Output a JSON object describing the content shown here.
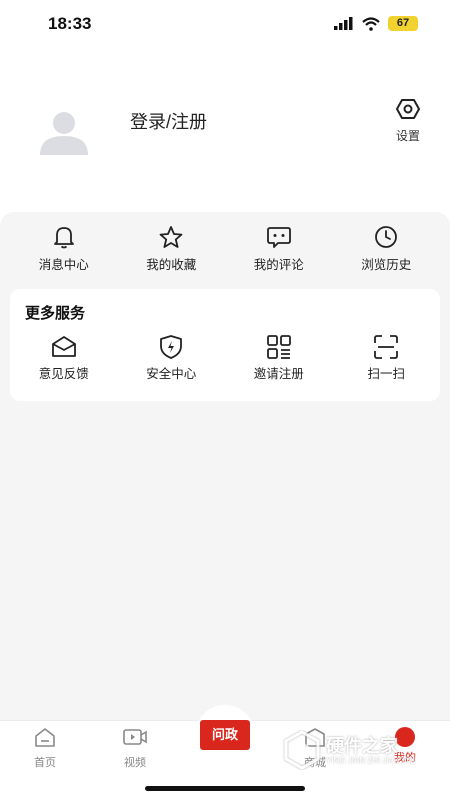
{
  "status_bar": {
    "time": "18:33",
    "battery": "67"
  },
  "profile": {
    "login_label": "登录/注册",
    "settings_label": "设置"
  },
  "quick_actions": [
    {
      "label": "消息中心",
      "icon": "bell-icon"
    },
    {
      "label": "我的收藏",
      "icon": "star-icon"
    },
    {
      "label": "我的评论",
      "icon": "comment-icon"
    },
    {
      "label": "浏览历史",
      "icon": "clock-icon"
    }
  ],
  "services": {
    "title": "更多服务",
    "items": [
      {
        "label": "意见反馈",
        "icon": "envelope-icon"
      },
      {
        "label": "安全中心",
        "icon": "shield-icon"
      },
      {
        "label": "邀请注册",
        "icon": "qrcode-icon"
      },
      {
        "label": "扫一扫",
        "icon": "scan-icon"
      }
    ]
  },
  "tab_bar": {
    "tabs": [
      {
        "label": "首页",
        "icon": "home-icon"
      },
      {
        "label": "视频",
        "icon": "video-icon"
      },
      {
        "label": "问政",
        "icon": "book-icon"
      },
      {
        "label": "商城",
        "icon": "shop-icon"
      },
      {
        "label": "我的",
        "icon": "profile-icon",
        "active": true
      }
    ]
  },
  "watermark": {
    "title": "硬件之家",
    "subtitle": "YING JIAN ZHI JIA.COM"
  },
  "colors": {
    "accent": "#d9271e",
    "background": "#f5f5f6",
    "battery": "#f2d22e"
  }
}
